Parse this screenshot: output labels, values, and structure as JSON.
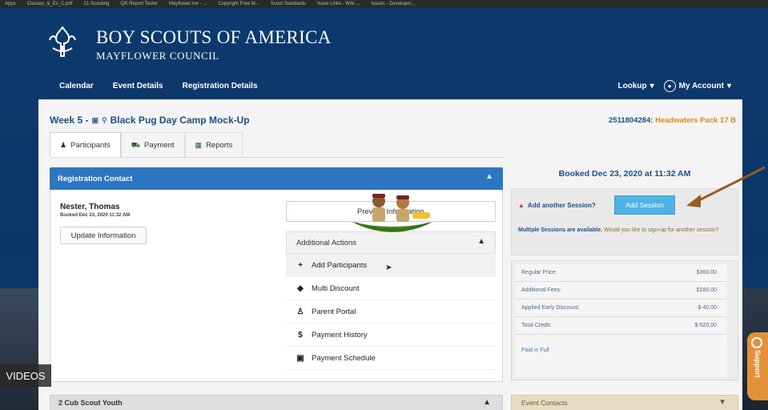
{
  "bookmarks": [
    "Apps",
    "Classes_&_Ev_C.pdf",
    "21-Scouting",
    "QR Report Tester",
    "Mayflower.me - ...",
    "Copyright Free M...",
    "Scout Standards",
    "Issue Links - Wiki ...",
    "Issues - Developer..."
  ],
  "header": {
    "org_line1": "BOY SCOUTS OF AMERICA",
    "org_line2": "MAYFLOWER COUNCIL"
  },
  "nav": {
    "items": [
      "Calendar",
      "Event Details",
      "Registration Details"
    ],
    "lookup": "Lookup",
    "account": "My Account"
  },
  "event": {
    "title": "Week 5 - ",
    "name": "Black Pug Day Camp Mock-Up",
    "booking_id": "2511804284:",
    "booking_name": "Headwaters Pack 17 B"
  },
  "tabs": [
    "Participants",
    "Payment",
    "Reports"
  ],
  "registration": {
    "heading": "Registration Contact",
    "contact_name": "Nester, Thomas",
    "booked": "Booked Dec 23, 2020 11:32 AM",
    "update_label": "Update Information",
    "preview_label": "Preview Information"
  },
  "actions": {
    "heading": "Additional Actions",
    "items": [
      {
        "icon": "plus",
        "label": "Add Participants"
      },
      {
        "icon": "tag",
        "label": "Multi Discount"
      },
      {
        "icon": "person",
        "label": "Parent Portal"
      },
      {
        "icon": "dollar",
        "label": "Payment History"
      },
      {
        "icon": "calendar",
        "label": "Payment Schedule"
      }
    ]
  },
  "session": {
    "booked_title": "Booked Dec 23, 2020 at 11:32 AM",
    "add_label": "Add another Session?",
    "add_button": "Add Session",
    "multi_bold": "Multiple Sessions are available.",
    "multi_text": "Would you like to sign-up for another session?"
  },
  "pricing": {
    "rows": [
      {
        "label": "Regular Price:",
        "amount": "$360.00"
      },
      {
        "label": "Additional Fees:",
        "amount": "$180.00"
      },
      {
        "label": "Applied Early Discount:",
        "amount": "$-40.00"
      },
      {
        "label": "Total Credit:",
        "amount": "$-520.00"
      }
    ],
    "status": "Paid in Full"
  },
  "bottom": {
    "youth": "2 Cub Scout Youth",
    "contacts": "Event Contacts"
  },
  "overlay": {
    "videos": "VIDEOS",
    "support": "Support"
  },
  "colors": {
    "brand_blue": "#0c3a6e",
    "panel_blue": "#2d76c3",
    "accent_orange": "#d88a1a",
    "add_session_button": "#4fb3e6",
    "arrow": "#9b5a1e"
  }
}
